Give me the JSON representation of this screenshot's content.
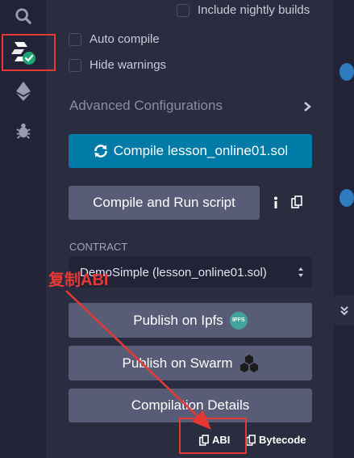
{
  "options": {
    "nightly_label": "Include nightly builds",
    "auto_compile_label": "Auto compile",
    "hide_warnings_label": "Hide warnings"
  },
  "advanced": {
    "title": "Advanced Configurations"
  },
  "compile_button": {
    "label": "Compile lesson_online01.sol"
  },
  "run_button": {
    "label": "Compile and Run script"
  },
  "contract": {
    "label": "CONTRACT",
    "selected": "DemoSimple (lesson_online01.sol)"
  },
  "publish_ipfs": {
    "label": "Publish on Ipfs",
    "badge": "IPFS"
  },
  "publish_swarm": {
    "label": "Publish on Swarm"
  },
  "details_button": {
    "label": "Compilation Details"
  },
  "copy_abi": {
    "label": "ABI"
  },
  "copy_bytecode": {
    "label": "Bytecode"
  },
  "annotation": {
    "text": "复制ABI",
    "color": "#e53935"
  },
  "colors": {
    "accent": "#007aa6",
    "annotation": "#e53935",
    "success": "#1ea672"
  }
}
